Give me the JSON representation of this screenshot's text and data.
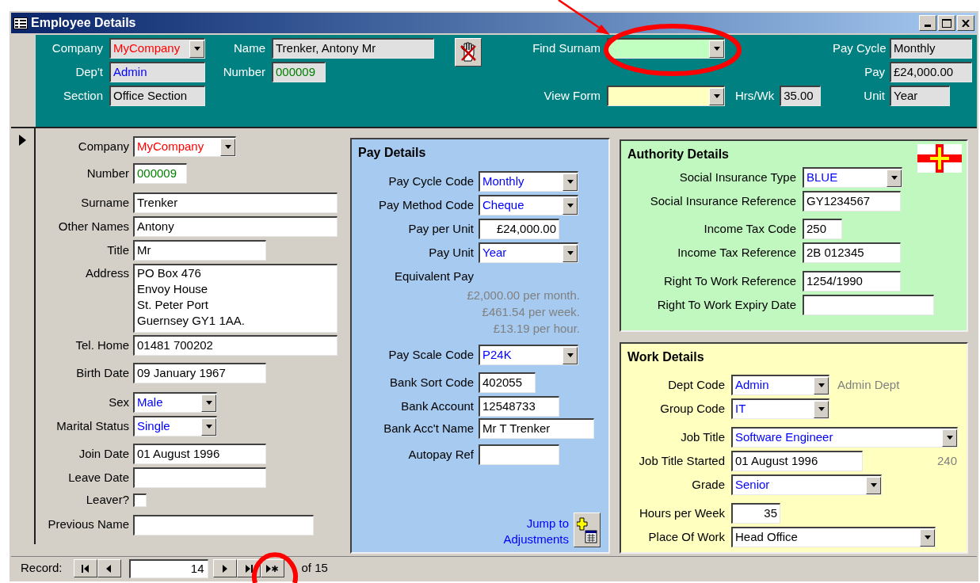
{
  "window": {
    "title": "Employee Details"
  },
  "header": {
    "col1": [
      {
        "label": "Company",
        "value": "MyCompany",
        "kind": "combo",
        "color": "#ff0000"
      },
      {
        "label": "Dep't",
        "value": "Admin",
        "kind": "text",
        "color": "#0000ff"
      },
      {
        "label": "Section",
        "value": "Office Section",
        "kind": "text"
      }
    ],
    "col2": [
      {
        "label": "Name",
        "value": "Trenker, Antony Mr",
        "kind": "text"
      },
      {
        "label": "Number",
        "value": "000009",
        "kind": "text",
        "color": "#008000"
      }
    ],
    "finder": [
      {
        "label": "Find Surnam",
        "kind": "combo"
      },
      {
        "label": "View Form",
        "kind": "combo"
      },
      {
        "label": "Hrs/Wk",
        "value": "35.00",
        "kind": "text"
      }
    ],
    "col4": [
      {
        "label": "Pay Cycle",
        "value": "Monthly",
        "kind": "text"
      },
      {
        "label": "Pay",
        "value": "£24,000.00",
        "kind": "text"
      },
      {
        "label": "Unit",
        "value": "Year",
        "kind": "text"
      }
    ]
  },
  "employee": [
    {
      "label": "Company",
      "value": "MyCompany",
      "kind": "combo",
      "color": "#ff0000"
    },
    {
      "label": "Number",
      "value": "000009",
      "kind": "text",
      "color": "#008000"
    },
    {
      "label": "Surname",
      "value": "Trenker",
      "kind": "text"
    },
    {
      "label": "Other Names",
      "value": "Antony",
      "kind": "text"
    },
    {
      "label": "Title",
      "value": "Mr",
      "kind": "text"
    },
    {
      "label": "Address",
      "lines": [
        "PO Box 476",
        "Envoy House",
        "St. Peter Port",
        "Guernsey GY1 1AA."
      ],
      "kind": "memo"
    },
    {
      "label": "Tel. Home",
      "value": "01481 700202",
      "kind": "text"
    },
    {
      "label": "Birth Date",
      "value": "09 January 1967",
      "kind": "text"
    },
    {
      "label": "Sex",
      "value": "Male",
      "kind": "combo",
      "color": "#0000ff"
    },
    {
      "label": "Marital Status",
      "value": "Single",
      "kind": "combo",
      "color": "#0000ff"
    },
    {
      "label": "Join Date",
      "value": "01 August 1996",
      "kind": "text"
    },
    {
      "label": "Leave Date",
      "kind": "text"
    },
    {
      "label": "Leaver?",
      "kind": "check",
      "checked": false
    },
    {
      "label": "Previous Name",
      "kind": "text"
    }
  ],
  "pay_details": {
    "title": "Pay Details",
    "fields": [
      {
        "label": "Pay Cycle Code",
        "value": "Monthly",
        "kind": "combo",
        "color": "#0000ff"
      },
      {
        "label": "Pay Method Code",
        "value": "Cheque",
        "kind": "combo",
        "color": "#0000ff"
      },
      {
        "label": "Pay per Unit",
        "value": "£24,000.00",
        "kind": "text"
      },
      {
        "label": "Pay Unit",
        "value": "Year",
        "kind": "combo",
        "color": "#0000ff"
      },
      {
        "label": "Equivalent Pay",
        "kind": "computed",
        "lines": [
          "£2,000.00 per month.",
          "£461.54 per week.",
          "£13.19 per hour."
        ]
      },
      {
        "label": "Pay Scale Code",
        "value": "P24K",
        "kind": "combo",
        "color": "#0000ff"
      },
      {
        "label": "Bank Sort Code",
        "value": "402055",
        "kind": "text"
      },
      {
        "label": "Bank Account",
        "value": "12548733",
        "kind": "text"
      },
      {
        "label": "Bank Acc't Name",
        "value": "Mr T Trenker",
        "kind": "text"
      },
      {
        "label": "Autopay Ref",
        "kind": "text"
      }
    ],
    "link": "Jump to Adjustments"
  },
  "authority_details": {
    "title": "Authority Details",
    "fields": [
      {
        "label": "Social Insurance Type",
        "value": "BLUE",
        "kind": "combo",
        "color": "#0000ff"
      },
      {
        "label": "Social Insurance Reference",
        "value": "GY1234567",
        "kind": "text"
      },
      {
        "label": "Income Tax Code",
        "value": "250",
        "kind": "text"
      },
      {
        "label": "Income Tax Reference",
        "value": "2B 012345",
        "kind": "text"
      },
      {
        "label": "Right To Work Reference",
        "value": "1254/1990",
        "kind": "text"
      },
      {
        "label": "Right To Work Expiry Date",
        "kind": "text"
      }
    ]
  },
  "work_details": {
    "title": "Work Details",
    "fields": [
      {
        "label": "Dept Code",
        "value": "Admin",
        "kind": "combo",
        "color": "#0000ff",
        "note": "Admin Dept"
      },
      {
        "label": "Group Code",
        "value": "IT",
        "kind": "combo",
        "color": "#0000ff"
      },
      {
        "label": "Job Title",
        "value": "Software Engineer",
        "kind": "combo",
        "color": "#0000ff"
      },
      {
        "label": "Job Title Started",
        "value": "01 August 1996",
        "kind": "text",
        "note": "240"
      },
      {
        "label": "Grade",
        "value": "Senior",
        "kind": "combo",
        "color": "#0000ff"
      },
      {
        "label": "Hours per Week",
        "value": "35",
        "kind": "text"
      },
      {
        "label": "Place Of Work",
        "value": "Head Office",
        "kind": "combo"
      }
    ]
  },
  "record_nav": {
    "label": "Record:",
    "current": "14",
    "total": "of 15"
  }
}
